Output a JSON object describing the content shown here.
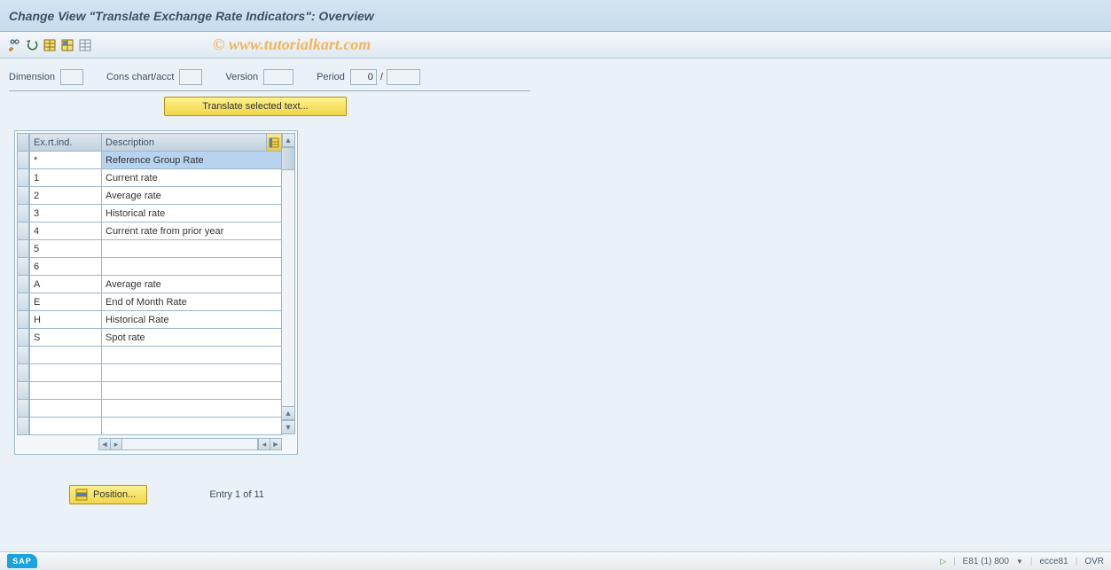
{
  "title": "Change View \"Translate Exchange Rate Indicators\": Overview",
  "watermark": "© www.tutorialkart.com",
  "toolbar": {
    "icons": [
      "toggle-pencil-icon",
      "undo-icon",
      "select-all-icon",
      "select-block-icon",
      "deselect-icon"
    ]
  },
  "params": {
    "dimension_label": "Dimension",
    "dimension_value": "",
    "cons_label": "Cons chart/acct",
    "cons_value": "",
    "version_label": "Version",
    "version_value": "",
    "period_label": "Period",
    "period_value": "0",
    "slash": "/",
    "year_value": ""
  },
  "buttons": {
    "translate": "Translate selected text...",
    "position": "Position..."
  },
  "table": {
    "headers": {
      "col1": "Ex.rt.ind.",
      "col2": "Description"
    },
    "rows": [
      {
        "ind": "*",
        "desc": "Reference Group Rate",
        "selected": true
      },
      {
        "ind": "1",
        "desc": "Current rate",
        "selected": false
      },
      {
        "ind": "2",
        "desc": "Average rate",
        "selected": false
      },
      {
        "ind": "3",
        "desc": "Historical rate",
        "selected": false
      },
      {
        "ind": "4",
        "desc": "Current rate from prior year",
        "selected": false
      },
      {
        "ind": "5",
        "desc": "",
        "selected": false
      },
      {
        "ind": "6",
        "desc": "",
        "selected": false
      },
      {
        "ind": "A",
        "desc": "Average rate",
        "selected": false
      },
      {
        "ind": "E",
        "desc": "End of Month Rate",
        "selected": false
      },
      {
        "ind": "H",
        "desc": "Historical Rate",
        "selected": false
      },
      {
        "ind": "S",
        "desc": "Spot rate",
        "selected": false
      },
      {
        "ind": "",
        "desc": "",
        "selected": false
      },
      {
        "ind": "",
        "desc": "",
        "selected": false
      },
      {
        "ind": "",
        "desc": "",
        "selected": false
      },
      {
        "ind": "",
        "desc": "",
        "selected": false
      },
      {
        "ind": "",
        "desc": "",
        "selected": false
      }
    ]
  },
  "entry_text": "Entry 1 of 11",
  "status": {
    "sap": "SAP",
    "session": "E81 (1) 800",
    "server": "ecce81",
    "mode": "OVR"
  }
}
